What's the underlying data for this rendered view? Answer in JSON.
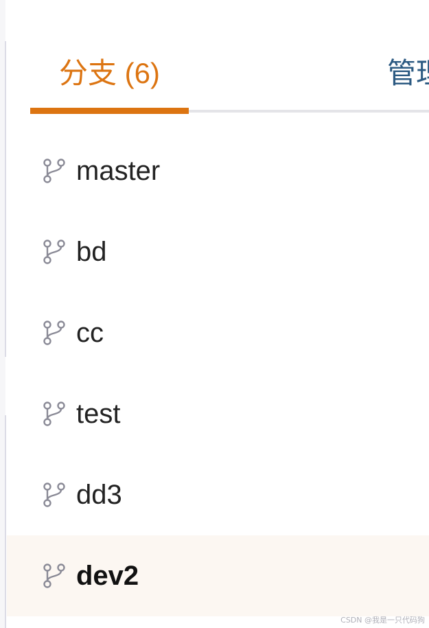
{
  "tabs": [
    {
      "label": "分支 (6)",
      "active": true
    },
    {
      "label": "管理",
      "active": false
    }
  ],
  "colors": {
    "accent": "#dc7411",
    "tab_inactive": "#2c5a82",
    "selected_row_bg": "#fcf7f2",
    "icon": "#8a8a96"
  },
  "branches": [
    {
      "name": "master",
      "icon": "git-branch-icon",
      "selected": false
    },
    {
      "name": "bd",
      "icon": "git-branch-icon",
      "selected": false
    },
    {
      "name": "cc",
      "icon": "git-branch-icon",
      "selected": false
    },
    {
      "name": "test",
      "icon": "git-branch-icon",
      "selected": false
    },
    {
      "name": "dd3",
      "icon": "git-branch-icon",
      "selected": false
    },
    {
      "name": "dev2",
      "icon": "git-branch-icon",
      "selected": true
    }
  ],
  "watermark": "CSDN @我是一只代码狗"
}
